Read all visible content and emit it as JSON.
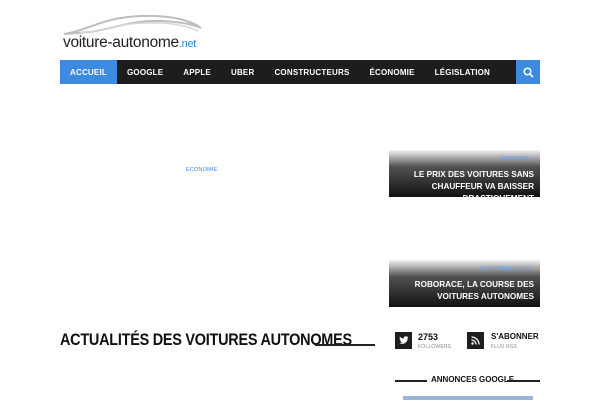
{
  "logo": {
    "text_main": "voiture-autono",
    "text_tail": "me",
    "text_net": ".net"
  },
  "nav": {
    "items": [
      {
        "label": "ACCUEIL",
        "active": true
      },
      {
        "label": "GOOGLE"
      },
      {
        "label": "APPLE"
      },
      {
        "label": "UBER"
      },
      {
        "label": "CONSTRUCTEURS"
      },
      {
        "label": "ÉCONOMIE"
      },
      {
        "label": "LÉGISLATION"
      }
    ],
    "search_icon": "search-icon"
  },
  "main_category": "ÉCONOMIE",
  "featured": [
    {
      "category": "ÉCONOMIE",
      "title": "LE PRIX DES VOITURES SANS CHAUFFEUR VA BAISSER DRASTIQUEMENT"
    },
    {
      "category": "CONSTRUCTEURS",
      "title": "ROBORACE, LA COURSE DES VOITURES AUTONOMES"
    }
  ],
  "section": {
    "title": "ACTUALITÉS DES VOITURES AUTONOMES"
  },
  "social": {
    "twitter": {
      "count": "2753",
      "label": "FOLLOWERS",
      "icon": "twitter-icon"
    },
    "rss": {
      "label_main": "S'ABONNER",
      "label_sub": "FLUX RSS",
      "icon": "rss-icon"
    }
  },
  "ads": {
    "title": "ANNONCES GOOGLE"
  },
  "colors": {
    "accent": "#3d8be0",
    "nav_bg": "#1d1d1d"
  }
}
